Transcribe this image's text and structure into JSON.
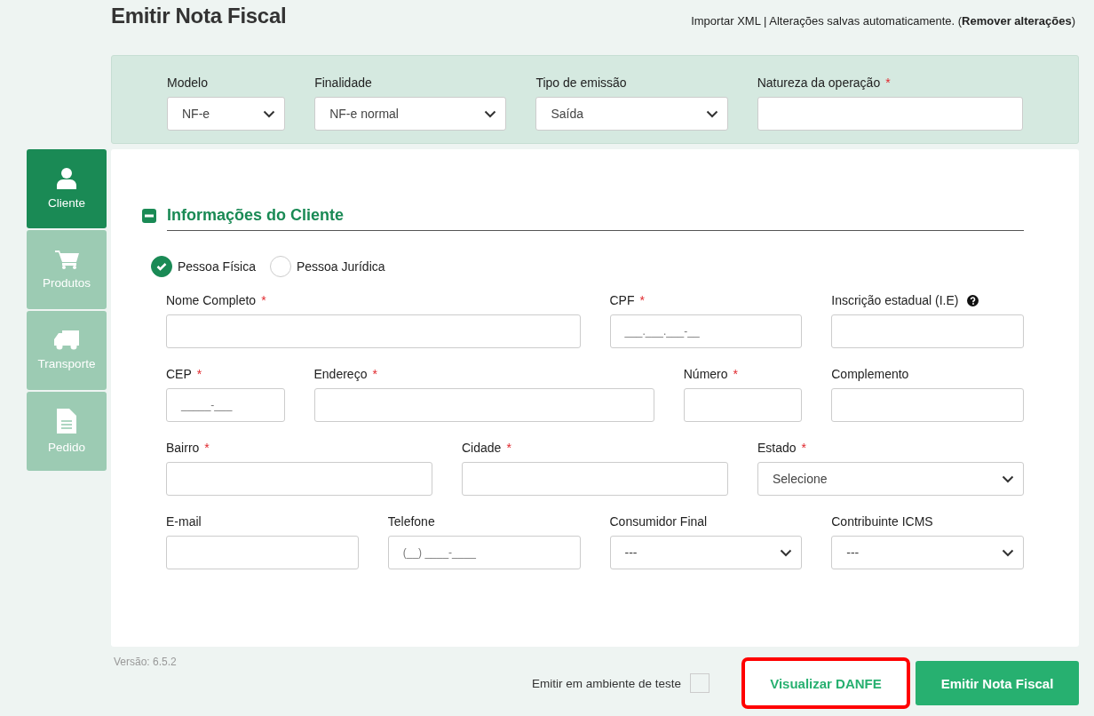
{
  "page": {
    "title": "Emitir Nota Fiscal",
    "import_link": "Importar XML",
    "autosave_text": "| Alterações salvas automaticamente. (",
    "remove_link": "Remover alterações",
    "autosave_end": ")"
  },
  "top_fields": [
    {
      "label": "Modelo",
      "kind": "select",
      "value": "NF-e"
    },
    {
      "label": "Finalidade",
      "kind": "select",
      "value": "NF-e normal"
    },
    {
      "label": "Tipo de emissão",
      "kind": "select",
      "value": "Saída"
    },
    {
      "label": "Natureza da operação",
      "required_mark": "*",
      "kind": "text"
    }
  ],
  "sidebar": [
    {
      "label": "Cliente",
      "selected": true
    },
    {
      "label": "Produtos",
      "selected": false
    },
    {
      "label": "Transporte",
      "selected": false
    },
    {
      "label": "Pedido",
      "selected": false
    }
  ],
  "section": {
    "title": "Informações do Cliente",
    "expanded": true
  },
  "person_types": [
    {
      "label": "Pessoa Física",
      "selected": true
    },
    {
      "label": "Pessoa Jurídica",
      "selected": false
    }
  ],
  "rows": [
    [
      {
        "label": "Nome Completo",
        "required_mark": "*",
        "kind": "text"
      },
      {
        "label": "CPF",
        "required_mark": "*",
        "kind": "text",
        "placeholder": "___.___.___-__"
      },
      {
        "label": "Inscrição estadual (I.E)",
        "help": true,
        "kind": "text"
      }
    ],
    [
      {
        "label": "CEP",
        "required_mark": "*",
        "kind": "text",
        "placeholder": "_____-___"
      },
      {
        "label": "Endereço",
        "required_mark": "*",
        "kind": "text"
      },
      {
        "label": "Número",
        "required_mark": "*",
        "kind": "text"
      },
      {
        "label": "Complemento",
        "kind": "text"
      }
    ],
    [
      {
        "label": "Bairro",
        "required_mark": "*",
        "kind": "text"
      },
      {
        "label": "Cidade",
        "required_mark": "*",
        "kind": "text"
      },
      {
        "label": "Estado",
        "required_mark": "*",
        "kind": "select",
        "value": "Selecione"
      }
    ],
    [
      {
        "label": "E-mail",
        "kind": "text"
      },
      {
        "label": "Telefone",
        "kind": "text",
        "placeholder": "(__) ____-____"
      },
      {
        "label": "Consumidor Final",
        "kind": "select",
        "value": "---"
      },
      {
        "label": "Contribuinte ICMS",
        "kind": "select",
        "value": "---"
      }
    ]
  ],
  "footer": {
    "version": "Versão: 6.5.2",
    "test_label": "Emitir em ambiente de teste",
    "test_checked": false,
    "buttons": [
      {
        "label": "Visualizar DANFE",
        "kind": "outline",
        "highlighted": true
      },
      {
        "label": "Emitir Nota Fiscal",
        "kind": "primary",
        "highlighted": false
      }
    ]
  }
}
